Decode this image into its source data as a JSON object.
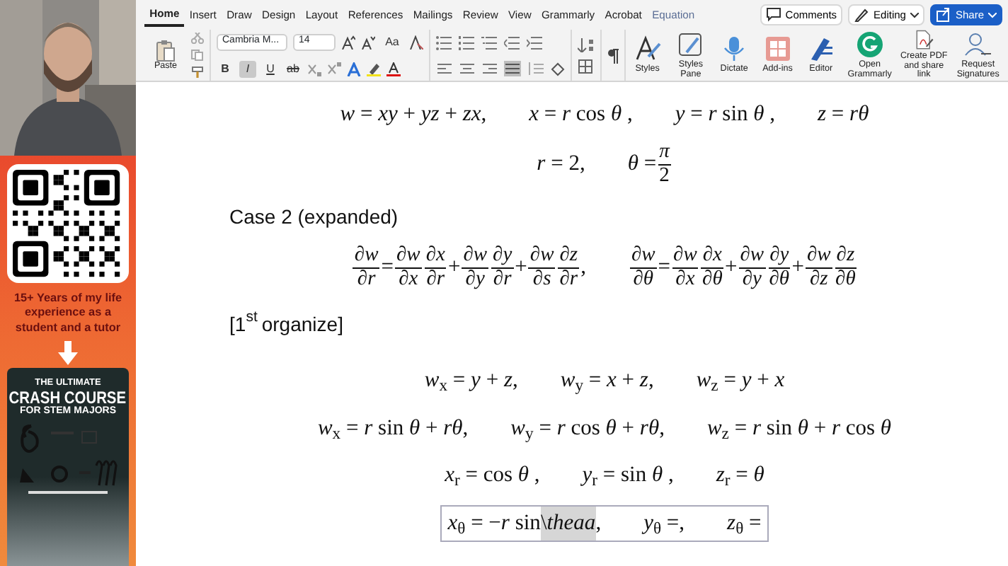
{
  "sidebar": {
    "promo_text": "15+ Years of my life experience as a student and a tutor",
    "book": {
      "title_lines": [
        "THE ULTIMATE",
        "CRASH COURSE",
        "FOR STEM MAJORS"
      ]
    }
  },
  "tabs": [
    {
      "label": "Home",
      "selected": true,
      "contextual": false
    },
    {
      "label": "Insert",
      "selected": false,
      "contextual": false
    },
    {
      "label": "Draw",
      "selected": false,
      "contextual": false
    },
    {
      "label": "Design",
      "selected": false,
      "contextual": false
    },
    {
      "label": "Layout",
      "selected": false,
      "contextual": false
    },
    {
      "label": "References",
      "selected": false,
      "contextual": false
    },
    {
      "label": "Mailings",
      "selected": false,
      "contextual": false
    },
    {
      "label": "Review",
      "selected": false,
      "contextual": false
    },
    {
      "label": "View",
      "selected": false,
      "contextual": false
    },
    {
      "label": "Grammarly",
      "selected": false,
      "contextual": false
    },
    {
      "label": "Acrobat",
      "selected": false,
      "contextual": false
    },
    {
      "label": "Equation",
      "selected": false,
      "contextual": true
    }
  ],
  "header_buttons": [
    {
      "label": "Comments",
      "kind": "comments"
    },
    {
      "label": "Editing",
      "kind": "editing"
    },
    {
      "label": "Share",
      "kind": "share"
    }
  ],
  "ribbon": {
    "paste": "Paste",
    "font_name": "Cambria M...",
    "font_size": "14",
    "case_button": "Aa",
    "format_toggles": [
      {
        "label": "B",
        "kind": "bold",
        "on": false
      },
      {
        "label": "I",
        "kind": "italic",
        "on": true
      },
      {
        "label": "U",
        "kind": "underline",
        "on": false
      },
      {
        "label": "ab",
        "kind": "strike",
        "on": false
      }
    ],
    "alignments": [
      {
        "selected": false
      },
      {
        "selected": false
      },
      {
        "selected": false
      },
      {
        "selected": true
      }
    ],
    "commands": [
      {
        "label": "Styles",
        "kind": "styles"
      },
      {
        "label": "Styles Pane",
        "kind": "pane"
      },
      {
        "label": "Dictate",
        "kind": "mic"
      },
      {
        "label": "Add-ins",
        "kind": "addins"
      },
      {
        "label": "Editor",
        "kind": "editor"
      },
      {
        "label": "Open Grammarly",
        "kind": "grammarly"
      },
      {
        "label": "Create PDF and share link",
        "kind": "pdf"
      },
      {
        "label": "Request Signatures",
        "kind": "sign"
      }
    ]
  },
  "document": [
    {
      "kind": "math",
      "exprs": [
        [
          "*w* = *xy* + *yz* + *zx*,"
        ],
        [
          "*x* = *r* cos *θ* ,"
        ],
        [
          "*y* = *r* sin *θ* ,"
        ],
        [
          "*z* = *rθ*"
        ]
      ]
    },
    {
      "kind": "math",
      "exprs": [
        [
          "*r* = 2,"
        ],
        [
          "*θ* = ",
          {
            "num": "*π*",
            "den": "2"
          }
        ]
      ]
    },
    {
      "kind": "text",
      "text": "Case 2 (expanded)"
    },
    {
      "kind": "math",
      "exprs": [
        [
          {
            "num": "∂*w*",
            "den": "∂*r*"
          },
          " = ",
          {
            "num": "∂*w*",
            "den": "∂*x*"
          },
          {
            "num": "∂*x*",
            "den": "∂*r*"
          },
          " + ",
          {
            "num": "∂*w*",
            "den": "∂*y*"
          },
          {
            "num": "∂*y*",
            "den": "∂*r*"
          },
          " + ",
          {
            "num": "∂*w*",
            "den": "∂*s*"
          },
          {
            "num": "∂*z*",
            "den": "∂*r*"
          },
          ","
        ],
        [
          {
            "num": "∂*w*",
            "den": "∂*θ*"
          },
          " = ",
          {
            "num": "∂*w*",
            "den": "∂*x*"
          },
          {
            "num": "∂*x*",
            "den": "∂*θ*"
          },
          " + ",
          {
            "num": "∂*w*",
            "den": "∂*y*"
          },
          {
            "num": "∂*y*",
            "den": "∂*θ*"
          },
          " + ",
          {
            "num": "∂*w*",
            "den": "∂*z*"
          },
          {
            "num": "∂*z*",
            "den": "∂*θ*"
          }
        ]
      ]
    },
    {
      "kind": "text",
      "text": "[1$^{st}$ organize]"
    },
    {
      "kind": "math",
      "exprs": [
        [
          "*w*$_{x}$ = *y* + *z*,"
        ],
        [
          "*w*$_{y}$ = *x* + *z*,"
        ],
        [
          "*w*$_{z}$ = *y* + *x*"
        ]
      ]
    },
    {
      "kind": "math",
      "exprs": [
        [
          "*w*$_{x}$ = *r* sin *θ* + *rθ*,"
        ],
        [
          "*w*$_{y}$ = *r* cos *θ* + *rθ*,"
        ],
        [
          "*w*$_{z}$ = *r* sin *θ* + *r* cos *θ*"
        ]
      ]
    },
    {
      "kind": "math",
      "exprs": [
        [
          "*x*$_{r}$ = cos *θ* ,"
        ],
        [
          "*y*$_{r}$ = sin *θ* ,"
        ],
        [
          "*z*$_{r}$ = *θ*"
        ]
      ]
    },
    {
      "kind": "math",
      "editing": true,
      "exprs": [
        [
          "*x*$_{θ}$ = −*r* sin",
          {
            "text": "\\*theaa*",
            "highlighted": true
          },
          ","
        ],
        [
          "*y*$_{θ}$ =,"
        ],
        [
          "*z*$_{θ}$ ="
        ]
      ]
    }
  ]
}
